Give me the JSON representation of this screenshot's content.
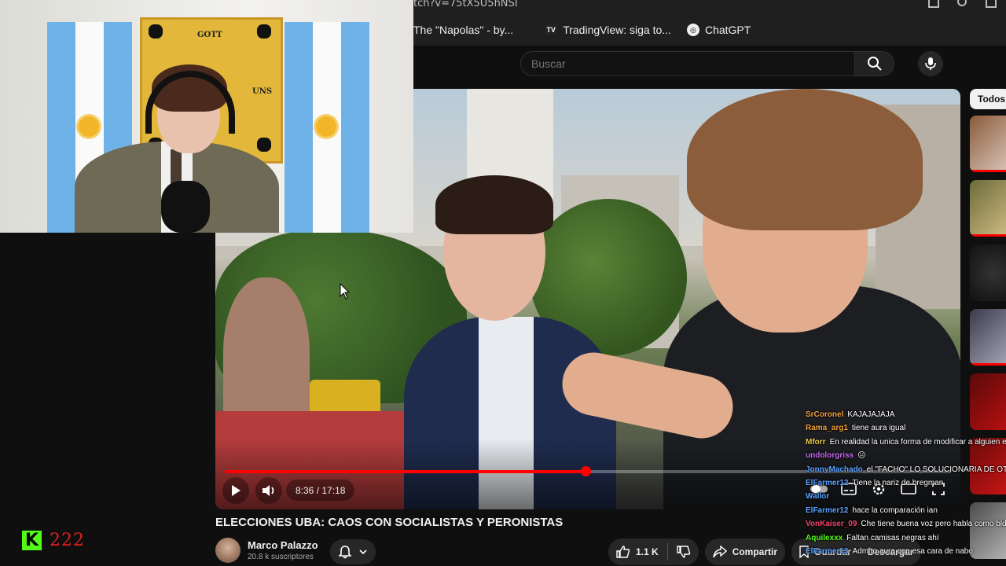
{
  "browser": {
    "url_fragment": "tch?v=75tX5U5hNSI",
    "bookmarks": [
      {
        "label": "The \"Napolas\" - by...",
        "icon": "substack-icon"
      },
      {
        "label": "TradingView: siga to...",
        "icon": "tradingview-icon",
        "glyph": "TV"
      },
      {
        "label": "ChatGPT",
        "icon": "chatgpt-icon",
        "glyph": "◎"
      }
    ]
  },
  "youtube": {
    "search": {
      "placeholder": "Buscar"
    },
    "chip_all": "Todos",
    "player": {
      "time": "8:36 / 17:18",
      "progress_fraction": 0.4966,
      "accent": "#ff0000"
    },
    "video": {
      "title": "ELECCIONES UBA: CAOS CON SOCIALISTAS Y PERONISTAS",
      "channel": "Marco Palazzo",
      "subscribers": "20.8 k suscriptores",
      "likes": "1.1 K",
      "share": "Compartir",
      "save": "Guardar",
      "download": "Descargar"
    }
  },
  "chat": [
    {
      "user": "SrCoronel",
      "color": "#f2a23a",
      "text": "KAJAJAJAJA"
    },
    {
      "user": "Rama_arg1",
      "color": "#f2a23a",
      "text": "tiene aura igual"
    },
    {
      "user": "Mforr",
      "color": "#e8c84a",
      "text": "En realidad la unica forma de modificar a alguien es ..."
    },
    {
      "user": "undolorgriss",
      "color": "#c36af0",
      "text": "😐"
    },
    {
      "user": "JonnyMachado",
      "color": "#5aa2ff",
      "text": "el \"FACHO\" LO SOLUCIONARIA DE OTRA M"
    },
    {
      "user": "ElFarmer12",
      "color": "#5aa2ff",
      "text": "Tiene la nariz de bregman"
    },
    {
      "user": "Wallor",
      "color": "#5aa2ff",
      "text": ""
    },
    {
      "user": "ElFarmer12",
      "color": "#5aa2ff",
      "text": "hace la comparación ian"
    },
    {
      "user": "VonKaiser_09",
      "color": "#f0466e",
      "text": "Che tiene buena voz pero habla como bld"
    },
    {
      "user": "Aquilexxx",
      "color": "#53fc18",
      "text": "Faltan camisas negras ahí"
    },
    {
      "user": "ElFarmer13",
      "color": "#5aa2ff",
      "text": "Admiro aura con esa cara de nabo"
    }
  ],
  "webcam": {
    "banner_top": "GOTT",
    "banner_bottom": "UNS"
  },
  "kick": {
    "logo": "K",
    "viewers": "222",
    "brand_color": "#53fc18"
  }
}
